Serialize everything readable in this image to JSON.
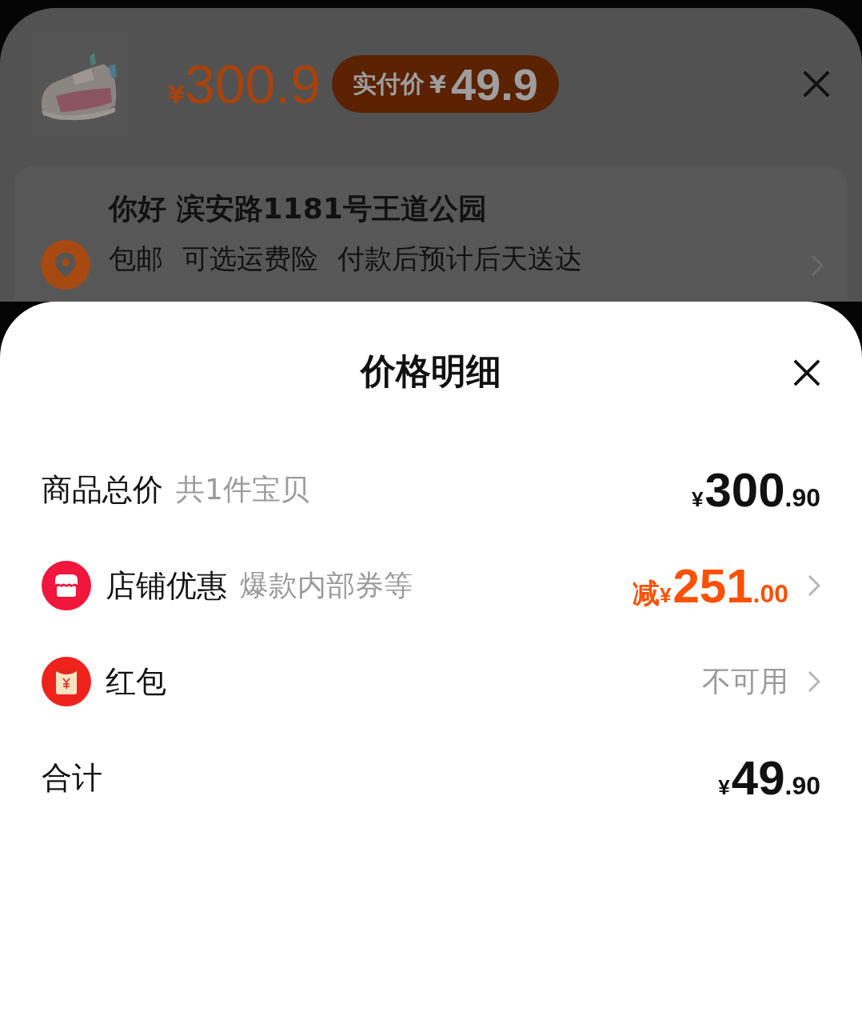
{
  "order_header": {
    "original_price": {
      "symbol": "¥",
      "amount": "300.9"
    },
    "pay_badge": {
      "label": "实付价",
      "symbol": "¥",
      "amount": "49.9"
    }
  },
  "address": {
    "title": "你好 滨安路1181号王道公园",
    "details": [
      "包邮",
      "可选运费险",
      "付款后预计后天送达"
    ]
  },
  "sheet": {
    "title": "价格明细",
    "rows": [
      {
        "kind": "plain",
        "label": "商品总价",
        "note": "共1件宝贝",
        "link": false,
        "discount": false,
        "amount": {
          "symbol": "¥",
          "integer": "300",
          "decimal": ".90"
        }
      },
      {
        "kind": "shop",
        "label": "店铺优惠",
        "note": "爆款内部券等",
        "link": true,
        "discount": true,
        "amount": {
          "prefix": "减",
          "symbol": "¥",
          "integer": "251",
          "decimal": ".00"
        }
      },
      {
        "kind": "packet",
        "label": "红包",
        "link": true,
        "status": "不可用"
      },
      {
        "kind": "plain",
        "label": "合计",
        "link": false,
        "discount": false,
        "amount": {
          "symbol": "¥",
          "integer": "49",
          "decimal": ".90"
        }
      }
    ]
  }
}
